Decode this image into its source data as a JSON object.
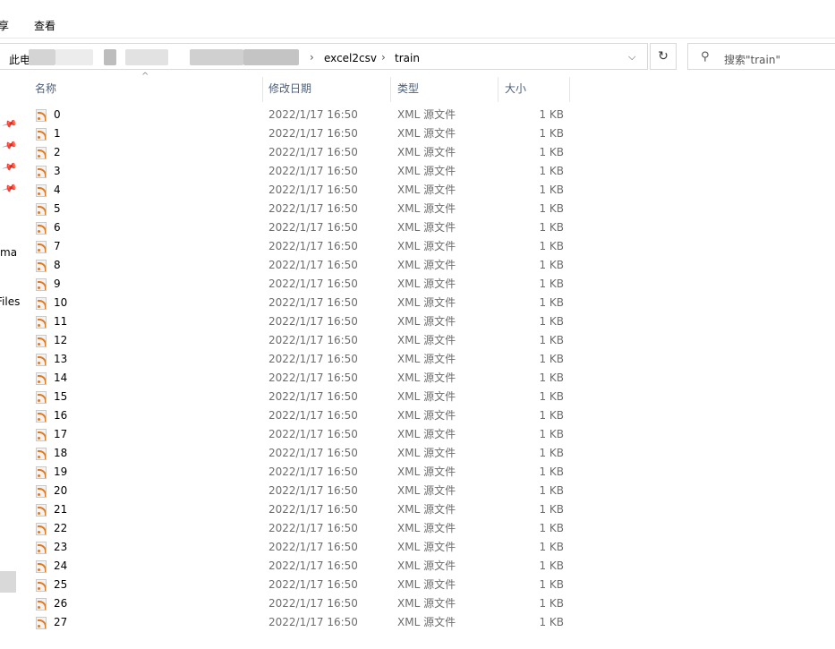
{
  "ribbon": {
    "share_label": "享",
    "view_label": "查看"
  },
  "address": {
    "root_label": "此电",
    "crumbs": [
      "excel2csv",
      "train"
    ],
    "refresh_icon": "refresh-icon",
    "dropdown_icon": "chevron-down-icon"
  },
  "search": {
    "placeholder": "搜索\"train\"",
    "icon": "search-icon"
  },
  "nav": {
    "item_ma": "ma",
    "item_files": "Files"
  },
  "columns": {
    "name": "名称",
    "date": "修改日期",
    "type": "类型",
    "size": "大小"
  },
  "files": [
    {
      "name": "0",
      "date": "2022/1/17 16:50",
      "type": "XML 源文件",
      "size": "1 KB"
    },
    {
      "name": "1",
      "date": "2022/1/17 16:50",
      "type": "XML 源文件",
      "size": "1 KB"
    },
    {
      "name": "2",
      "date": "2022/1/17 16:50",
      "type": "XML 源文件",
      "size": "1 KB"
    },
    {
      "name": "3",
      "date": "2022/1/17 16:50",
      "type": "XML 源文件",
      "size": "1 KB"
    },
    {
      "name": "4",
      "date": "2022/1/17 16:50",
      "type": "XML 源文件",
      "size": "1 KB"
    },
    {
      "name": "5",
      "date": "2022/1/17 16:50",
      "type": "XML 源文件",
      "size": "1 KB"
    },
    {
      "name": "6",
      "date": "2022/1/17 16:50",
      "type": "XML 源文件",
      "size": "1 KB"
    },
    {
      "name": "7",
      "date": "2022/1/17 16:50",
      "type": "XML 源文件",
      "size": "1 KB"
    },
    {
      "name": "8",
      "date": "2022/1/17 16:50",
      "type": "XML 源文件",
      "size": "1 KB"
    },
    {
      "name": "9",
      "date": "2022/1/17 16:50",
      "type": "XML 源文件",
      "size": "1 KB"
    },
    {
      "name": "10",
      "date": "2022/1/17 16:50",
      "type": "XML 源文件",
      "size": "1 KB"
    },
    {
      "name": "11",
      "date": "2022/1/17 16:50",
      "type": "XML 源文件",
      "size": "1 KB"
    },
    {
      "name": "12",
      "date": "2022/1/17 16:50",
      "type": "XML 源文件",
      "size": "1 KB"
    },
    {
      "name": "13",
      "date": "2022/1/17 16:50",
      "type": "XML 源文件",
      "size": "1 KB"
    },
    {
      "name": "14",
      "date": "2022/1/17 16:50",
      "type": "XML 源文件",
      "size": "1 KB"
    },
    {
      "name": "15",
      "date": "2022/1/17 16:50",
      "type": "XML 源文件",
      "size": "1 KB"
    },
    {
      "name": "16",
      "date": "2022/1/17 16:50",
      "type": "XML 源文件",
      "size": "1 KB"
    },
    {
      "name": "17",
      "date": "2022/1/17 16:50",
      "type": "XML 源文件",
      "size": "1 KB"
    },
    {
      "name": "18",
      "date": "2022/1/17 16:50",
      "type": "XML 源文件",
      "size": "1 KB"
    },
    {
      "name": "19",
      "date": "2022/1/17 16:50",
      "type": "XML 源文件",
      "size": "1 KB"
    },
    {
      "name": "20",
      "date": "2022/1/17 16:50",
      "type": "XML 源文件",
      "size": "1 KB"
    },
    {
      "name": "21",
      "date": "2022/1/17 16:50",
      "type": "XML 源文件",
      "size": "1 KB"
    },
    {
      "name": "22",
      "date": "2022/1/17 16:50",
      "type": "XML 源文件",
      "size": "1 KB"
    },
    {
      "name": "23",
      "date": "2022/1/17 16:50",
      "type": "XML 源文件",
      "size": "1 KB"
    },
    {
      "name": "24",
      "date": "2022/1/17 16:50",
      "type": "XML 源文件",
      "size": "1 KB"
    },
    {
      "name": "25",
      "date": "2022/1/17 16:50",
      "type": "XML 源文件",
      "size": "1 KB"
    },
    {
      "name": "26",
      "date": "2022/1/17 16:50",
      "type": "XML 源文件",
      "size": "1 KB"
    },
    {
      "name": "27",
      "date": "2022/1/17 16:50",
      "type": "XML 源文件",
      "size": "1 KB"
    }
  ],
  "colors": {
    "header_text": "#4c607a",
    "meta_text": "#6d6d6d",
    "rss_orange": "#e07b22"
  }
}
